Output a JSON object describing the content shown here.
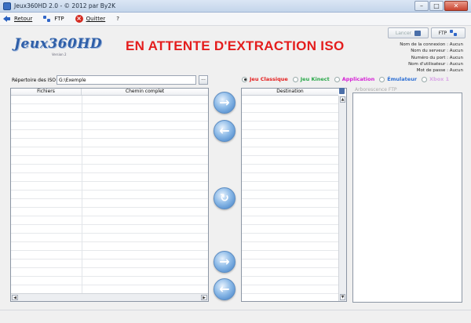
{
  "window": {
    "title": "Jeux360HD 2.0 - © 2012 par By2K",
    "min": "–",
    "max": "□",
    "close": "✕"
  },
  "menu": {
    "back": "Retour",
    "ftp": "FTP",
    "quit": "Quitter",
    "help": "?"
  },
  "header": {
    "logo": "Jeux360HD",
    "logo_sub": "Version 2",
    "status": "EN ATTENTE D'EXTRACTION ISO",
    "lancer_button": "Lancer",
    "ftp_button": "FTP"
  },
  "connection": [
    "Nom de la connexion : Aucun",
    "Nom du serveur : Aucun",
    "Numéro du port : Aucun",
    "Nom d'utilisateur : Aucun",
    "Mot de passe : Aucun"
  ],
  "iso_dir": {
    "label": "Répertoire des ISO :",
    "value": "G:\\Exemple",
    "browse": "..."
  },
  "game_types": [
    {
      "label": "Jeu Classique",
      "color": "#e41d1d",
      "selected": true
    },
    {
      "label": "Jeu Kinect",
      "color": "#2aa84a",
      "selected": false
    },
    {
      "label": "Application",
      "color": "#d51fd5",
      "selected": false
    },
    {
      "label": "Émulateur",
      "color": "#2d6fd4",
      "selected": false
    },
    {
      "label": "Xbox 1",
      "color": "#d9a6e6",
      "selected": false
    }
  ],
  "files_table": {
    "col_files": "Fichiers",
    "col_path": "Chemin complet"
  },
  "destination": {
    "header": "Destination"
  },
  "ftp_tree": {
    "label": "Arborescence FTP"
  },
  "icons": {
    "add": "→",
    "remove": "←",
    "refresh": "↻",
    "upload": "→",
    "download": "←"
  }
}
